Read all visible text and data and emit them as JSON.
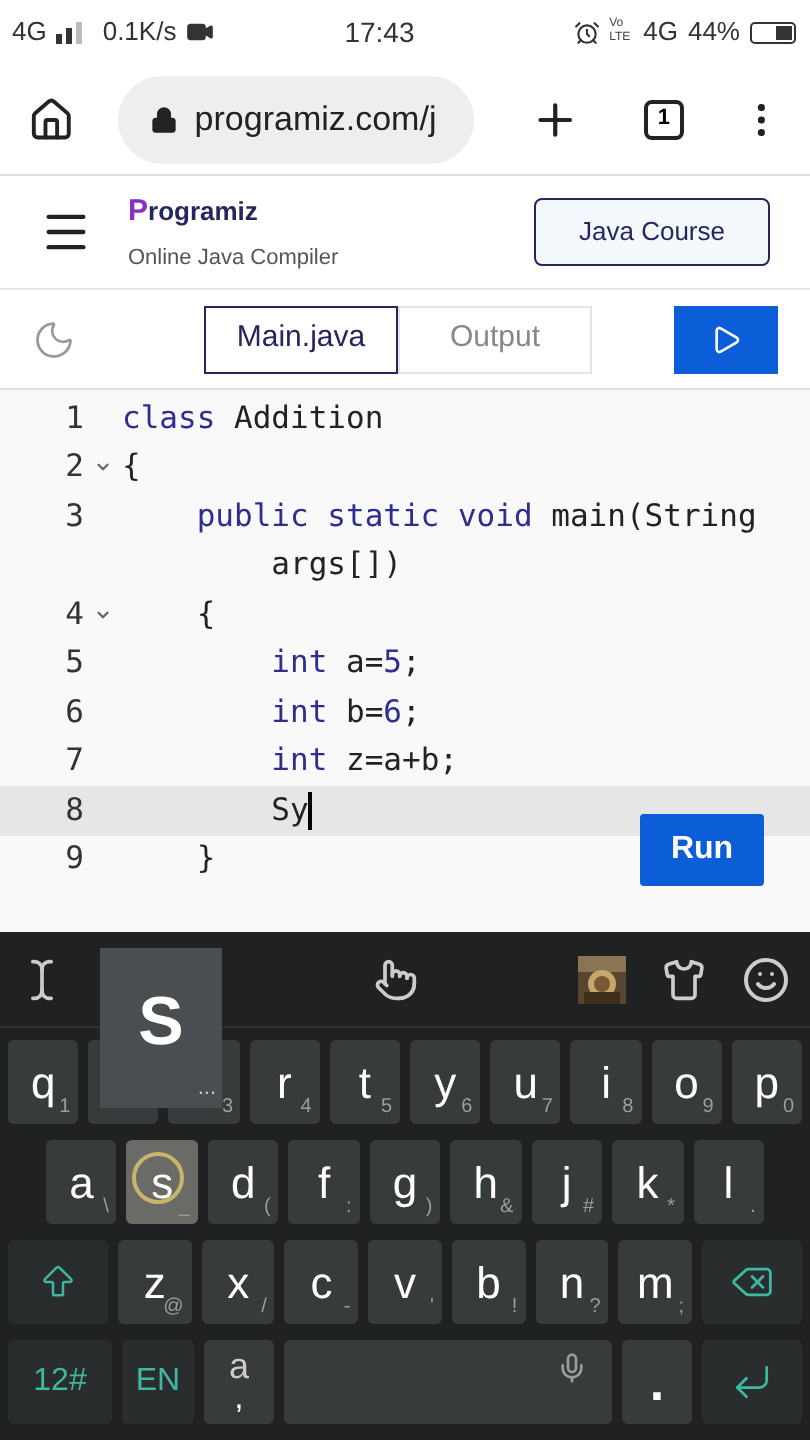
{
  "status_bar": {
    "network": "4G",
    "speed": "0.1K/s",
    "time": "17:43",
    "volte": "Vo LTE",
    "network_right": "4G",
    "battery": "44%"
  },
  "browser": {
    "url": "programiz.com/j",
    "tab_count": "1"
  },
  "header": {
    "logo_initial": "P",
    "logo_rest": "rogramiz",
    "subtitle": "Online Java Compiler",
    "course_button": "Java Course"
  },
  "editor_tabs": [
    {
      "label": "Main.java",
      "selected": true
    },
    {
      "label": "Output",
      "selected": false
    }
  ],
  "code_lines": [
    {
      "number": "1",
      "foldable": false,
      "active": false,
      "tokens": [
        {
          "text": "class",
          "kind": "keyword"
        },
        {
          "text": " Addition",
          "kind": "plain"
        }
      ]
    },
    {
      "number": "2",
      "foldable": true,
      "active": false,
      "tokens": [
        {
          "text": "{",
          "kind": "plain"
        }
      ]
    },
    {
      "number": "3",
      "foldable": false,
      "active": false,
      "tokens": [
        {
          "text": "    public static void",
          "kind": "keyword"
        },
        {
          "text": " main(String",
          "kind": "plain"
        }
      ],
      "continuation": "        args[])"
    },
    {
      "number": "4",
      "foldable": true,
      "active": false,
      "tokens": [
        {
          "text": "    {",
          "kind": "plain"
        }
      ]
    },
    {
      "number": "5",
      "foldable": false,
      "active": false,
      "tokens": [
        {
          "text": "        int",
          "kind": "keyword"
        },
        {
          "text": " a=",
          "kind": "plain"
        },
        {
          "text": "5",
          "kind": "number"
        },
        {
          "text": ";",
          "kind": "plain"
        }
      ]
    },
    {
      "number": "6",
      "foldable": false,
      "active": false,
      "tokens": [
        {
          "text": "        int",
          "kind": "keyword"
        },
        {
          "text": " b=",
          "kind": "plain"
        },
        {
          "text": "6",
          "kind": "number"
        },
        {
          "text": ";",
          "kind": "plain"
        }
      ]
    },
    {
      "number": "7",
      "foldable": false,
      "active": false,
      "tokens": [
        {
          "text": "        int",
          "kind": "keyword"
        },
        {
          "text": " z=a+b;",
          "kind": "plain"
        }
      ]
    },
    {
      "number": "8",
      "foldable": false,
      "active": true,
      "tokens": [
        {
          "text": "        Sy",
          "kind": "plain"
        }
      ]
    },
    {
      "number": "9",
      "foldable": false,
      "active": false,
      "tokens": [
        {
          "text": "    }",
          "kind": "plain"
        }
      ]
    }
  ],
  "run_button": "Run",
  "keyboard": {
    "popup": {
      "letter": "S",
      "ellipsis": "..."
    },
    "rows": [
      {
        "keys": [
          {
            "kind": "letter",
            "letter": "q",
            "hint": "1",
            "pressed": false
          },
          {
            "kind": "covered"
          },
          {
            "kind": "covered",
            "hint": "3"
          },
          {
            "kind": "letter",
            "letter": "r",
            "hint": "4",
            "pressed": false
          },
          {
            "kind": "letter",
            "letter": "t",
            "hint": "5",
            "pressed": false
          },
          {
            "kind": "letter",
            "letter": "y",
            "hint": "6",
            "pressed": false
          },
          {
            "kind": "letter",
            "letter": "u",
            "hint": "7",
            "pressed": false
          },
          {
            "kind": "letter",
            "letter": "i",
            "hint": "8",
            "pressed": false
          },
          {
            "kind": "letter",
            "letter": "o",
            "hint": "9",
            "pressed": false
          },
          {
            "kind": "letter",
            "letter": "p",
            "hint": "0",
            "pressed": false
          }
        ]
      },
      {
        "keys": [
          {
            "kind": "letter",
            "letter": "a",
            "hint": "\\",
            "pressed": false
          },
          {
            "kind": "letter",
            "letter": "s",
            "hint": "_",
            "pressed": true
          },
          {
            "kind": "letter",
            "letter": "d",
            "hint": "(",
            "pressed": false
          },
          {
            "kind": "letter",
            "letter": "f",
            "hint": ":",
            "pressed": false
          },
          {
            "kind": "letter",
            "letter": "g",
            "hint": ")",
            "pressed": false
          },
          {
            "kind": "letter",
            "letter": "h",
            "hint": "&",
            "pressed": false
          },
          {
            "kind": "letter",
            "letter": "j",
            "hint": "#",
            "pressed": false
          },
          {
            "kind": "letter",
            "letter": "k",
            "hint": "*",
            "pressed": false
          },
          {
            "kind": "letter",
            "letter": "l",
            "hint": ".",
            "pressed": false
          }
        ]
      },
      {
        "keys": [
          {
            "kind": "shift"
          },
          {
            "kind": "letter",
            "letter": "z",
            "hint": "@",
            "pressed": false
          },
          {
            "kind": "letter",
            "letter": "x",
            "hint": "/",
            "pressed": false
          },
          {
            "kind": "letter",
            "letter": "c",
            "hint": "-",
            "pressed": false
          },
          {
            "kind": "letter",
            "letter": "v",
            "hint": "'",
            "pressed": false
          },
          {
            "kind": "letter",
            "letter": "b",
            "hint": "!",
            "pressed": false
          },
          {
            "kind": "letter",
            "letter": "n",
            "hint": "?",
            "pressed": false
          },
          {
            "kind": "letter",
            "letter": "m",
            "hint": ";",
            "pressed": false
          },
          {
            "kind": "backspace"
          }
        ]
      },
      {
        "keys": [
          {
            "kind": "mode",
            "label": "12#"
          },
          {
            "kind": "mode",
            "label": "EN"
          },
          {
            "kind": "stacked",
            "letter": "a",
            "hint": ","
          },
          {
            "kind": "space"
          },
          {
            "kind": "period",
            "label": "."
          },
          {
            "kind": "enter"
          }
        ]
      }
    ]
  }
}
